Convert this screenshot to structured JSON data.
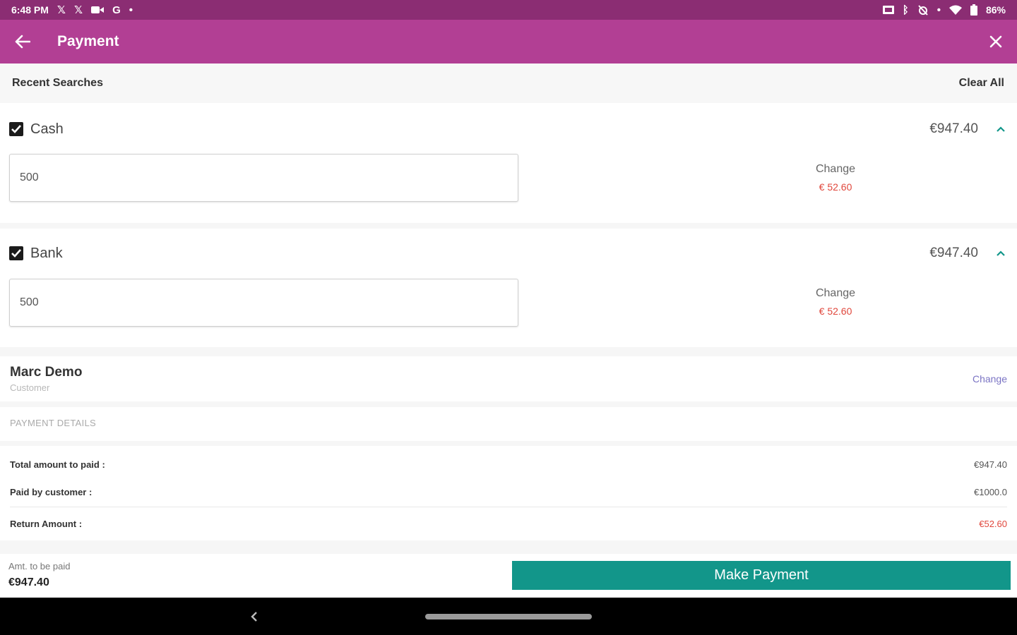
{
  "status_bar": {
    "time": "6:48 PM",
    "battery": "86%",
    "left_icons": [
      "x-logo-icon",
      "x-logo-icon",
      "video-icon",
      "google-icon",
      "dot-icon"
    ],
    "right_icons": [
      "cast-icon",
      "bluetooth-icon",
      "no-alarm-icon",
      "wifi-icon",
      "battery-icon"
    ]
  },
  "app_bar": {
    "title": "Payment",
    "back_icon": "arrow-left-icon",
    "close_icon": "close-icon",
    "color": "#b23f94"
  },
  "recent": {
    "title": "Recent Searches",
    "clear_all": "Clear All"
  },
  "methods": [
    {
      "label": "Cash",
      "checked": true,
      "amount": "€947.40",
      "input_value": "500",
      "change_label": "Change",
      "change_value": "€ 52.60"
    },
    {
      "label": "Bank",
      "checked": true,
      "amount": "€947.40",
      "input_value": "500",
      "change_label": "Change",
      "change_value": "€ 52.60"
    }
  ],
  "customer": {
    "name": "Marc Demo",
    "role": "Customer",
    "change_label": "Change"
  },
  "payment_details": {
    "header": "PAYMENT DETAILS",
    "rows": [
      {
        "label": "Total amount to paid :",
        "value": "€947.40"
      },
      {
        "label": "Paid by customer :",
        "value": "€1000.0"
      },
      {
        "label": "Return Amount :",
        "value": "€52.60"
      }
    ]
  },
  "bottom": {
    "amount_label": "Amt. to be paid",
    "amount_value": "€947.40",
    "button_label": "Make Payment",
    "button_color": "#12968a"
  },
  "colors": {
    "status_bar": "#8b2d73",
    "accent_red": "#e0473c",
    "link_purple": "#7b74c4",
    "chevron_teal": "#12968a"
  }
}
